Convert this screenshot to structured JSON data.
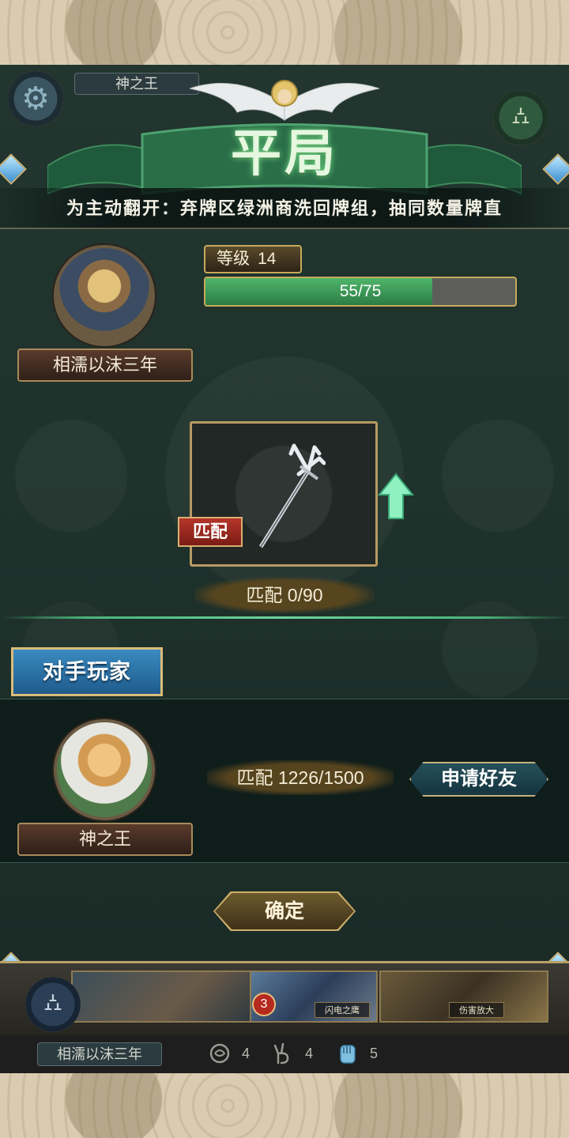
{
  "header": {
    "opponent_name_tag": "神之王",
    "title": "平局",
    "description": "为主动翻开：弃牌区绿洲商洗回牌组，抽同数量牌直"
  },
  "player": {
    "name": "相濡以沫三年",
    "level_label": "等级",
    "level_value": "14",
    "xp_text": "55/75",
    "xp_fraction": 0.733
  },
  "reward": {
    "tag": "匹配",
    "progress_text": "匹配 0/90"
  },
  "opponent": {
    "section_label": "对手玩家",
    "name": "神之王",
    "match_text": "匹配 1226/1500",
    "friend_button": "申请好友"
  },
  "actions": {
    "confirm_button": "确定"
  },
  "hand": {
    "card_cost": "3",
    "caption_a": "闪电之鹰",
    "caption_b": "伤害放大"
  },
  "status": {
    "player_name": "相濡以沫三年",
    "stat1_value": "4",
    "stat2_value": "4",
    "stat3_value": "5",
    "stat1_icon": "rose-icon",
    "stat2_icon": "victory-hand-icon",
    "stat3_icon": "open-hand-icon"
  },
  "colors": {
    "title_glow": "#7be38a",
    "xp_fill": "#3f9e5a",
    "opponent_label": "#2f74a8",
    "match_tag": "#a32c22"
  }
}
